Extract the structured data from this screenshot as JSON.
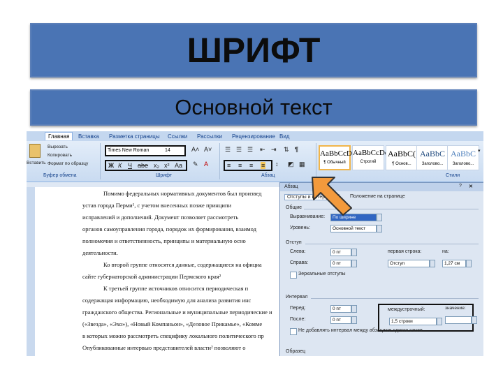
{
  "slide": {
    "title": "ШРИФТ",
    "subtitle": "Основной текст"
  },
  "ribbon": {
    "tabs": [
      "Главная",
      "Вставка",
      "Разметка страницы",
      "Ссылки",
      "Рассылки",
      "Рецензирование",
      "Вид"
    ],
    "active_tab": "Главная",
    "clipboard": {
      "paste": "Вставить",
      "cut": "Вырезать",
      "copy": "Копировать",
      "format_painter": "Формат по образцу",
      "label": "Буфер обмена"
    },
    "font": {
      "name": "Times New Roman",
      "size": "14",
      "label": "Шрифт"
    },
    "paragraph_label": "Абзац",
    "styles_label": "Стили",
    "styles": [
      {
        "sample": "AaBbCcDd",
        "name": "¶ Обычный"
      },
      {
        "sample": "AaBbCcDd",
        "name": "Строгий"
      },
      {
        "sample": "AaBbC(",
        "name": "¶ Основ..."
      },
      {
        "sample": "AaBbC",
        "name": "Заголово..."
      },
      {
        "sample": "AaBbC",
        "name": "Заголово..."
      }
    ]
  },
  "document": {
    "lines": [
      "Помимо федеральных нормативных документов был произвед",
      "устав города Перми¹, с учетом внесенных позже принципи",
      "исправлений и дополнений. Документ позволяет рассмотреть",
      "органов самоуправления города, порядок их формирования, взаимод",
      "полномочия и ответственность, принципы и материальную осно",
      "деятельности.",
      "Ко второй группе относятся данные, содержащиеся на официа",
      "сайте губернаторской администрации Пермского края²",
      "К третьей группе источников относится периодическая п",
      "содержащая информацию, необходимую для анализа развития инс",
      "гражданского общества. Региональные и муниципальные периодические и",
      "(«Звезда», «Эхо»), «Новый Компаньон», «Деловое Прикамье», «Комме",
      "в которых можно рассмотреть специфику локального политического пр",
      "Опубликованные интервью представителей власти² позволяют о"
    ]
  },
  "dialog": {
    "title": "Абзац",
    "tabs": [
      "Отступы и интервалы",
      "Положение на странице"
    ],
    "general": {
      "label": "Общие",
      "alignment_label": "Выравнивание:",
      "alignment_value": "По ширине",
      "level_label": "Уровень:",
      "level_value": "Основной текст"
    },
    "indent": {
      "label": "Отступ",
      "left_label": "Слева:",
      "left_value": "0 пт",
      "right_label": "Справа:",
      "right_value": "0 пт",
      "first_line_label": "первая строка:",
      "first_line_value": "Отступ",
      "by_label": "на:",
      "by_value": "1,27 см",
      "mirror_label": "Зеркальные отступы"
    },
    "spacing": {
      "label": "Интервал",
      "before_label": "Перед:",
      "before_value": "0 пт",
      "after_label": "После:",
      "after_value": "0 пт",
      "line_label": "междустрочный:",
      "line_value": "1,5 строки",
      "value_label": "значение:",
      "no_space_label": "Не добавлять интервал между абзацами одного стиля"
    },
    "preview_label": "Образец"
  },
  "colors": {
    "banner": "#4a74b4",
    "arrow": "#f39a3c"
  }
}
